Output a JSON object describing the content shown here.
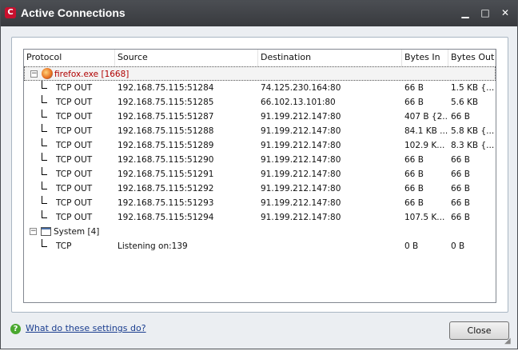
{
  "window": {
    "title": "Active Connections",
    "app_icon": "C",
    "minimize_glyph": "▁",
    "maximize_glyph": "□",
    "close_glyph": "✕"
  },
  "columns": [
    "Protocol",
    "Source",
    "Destination",
    "Bytes In",
    "Bytes Out"
  ],
  "groups": [
    {
      "label": "firefox.exe [1668]",
      "icon": "firefox-icon",
      "rows": [
        {
          "protocol": "TCP OUT",
          "source": "192.168.75.115:51284",
          "destination": "74.125.230.164:80",
          "bytes_in": "66 B",
          "bytes_out": "1.5 KB {..."
        },
        {
          "protocol": "TCP OUT",
          "source": "192.168.75.115:51285",
          "destination": "66.102.13.101:80",
          "bytes_in": "66 B",
          "bytes_out": "5.6 KB"
        },
        {
          "protocol": "TCP OUT",
          "source": "192.168.75.115:51287",
          "destination": "91.199.212.147:80",
          "bytes_in": "407 B {2...",
          "bytes_out": "66 B"
        },
        {
          "protocol": "TCP OUT",
          "source": "192.168.75.115:51288",
          "destination": "91.199.212.147:80",
          "bytes_in": "84.1 KB ...",
          "bytes_out": "5.8 KB {..."
        },
        {
          "protocol": "TCP OUT",
          "source": "192.168.75.115:51289",
          "destination": "91.199.212.147:80",
          "bytes_in": "102.9 K...",
          "bytes_out": "8.3 KB {..."
        },
        {
          "protocol": "TCP OUT",
          "source": "192.168.75.115:51290",
          "destination": "91.199.212.147:80",
          "bytes_in": "66 B",
          "bytes_out": "66 B"
        },
        {
          "protocol": "TCP OUT",
          "source": "192.168.75.115:51291",
          "destination": "91.199.212.147:80",
          "bytes_in": "66 B",
          "bytes_out": "66 B"
        },
        {
          "protocol": "TCP OUT",
          "source": "192.168.75.115:51292",
          "destination": "91.199.212.147:80",
          "bytes_in": "66 B",
          "bytes_out": "66 B"
        },
        {
          "protocol": "TCP OUT",
          "source": "192.168.75.115:51293",
          "destination": "91.199.212.147:80",
          "bytes_in": "66 B",
          "bytes_out": "66 B"
        },
        {
          "protocol": "TCP OUT",
          "source": "192.168.75.115:51294",
          "destination": "91.199.212.147:80",
          "bytes_in": "107.5 K...",
          "bytes_out": "66 B"
        }
      ]
    },
    {
      "label": "System [4]",
      "icon": "system-window-icon",
      "rows": [
        {
          "protocol": "TCP",
          "source": "Listening on:139",
          "destination": "",
          "bytes_in": "0 B",
          "bytes_out": "0 B"
        }
      ]
    }
  ],
  "footer": {
    "help_icon": "?",
    "help_link": "What do these settings do?",
    "close_label": "Close"
  },
  "colors": {
    "titlebar": "#3f4146",
    "selected_group_text": "#b00000",
    "link": "#1a3d8f"
  }
}
